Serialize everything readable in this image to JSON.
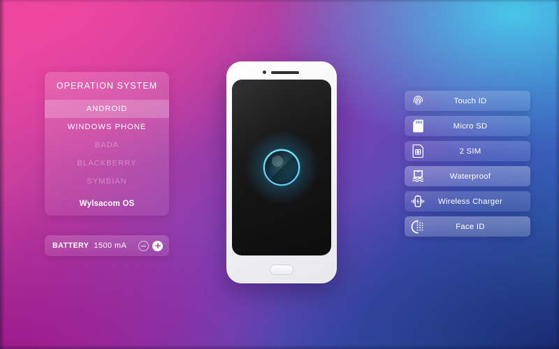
{
  "background": {
    "corner_top_left": "#ee4aa2",
    "corner_top_right": "#46cdeb",
    "corner_bottom_left": "#9e198c",
    "corner_bottom_right": "#1a266e"
  },
  "os_panel": {
    "title": "OPERATION SYSTEM",
    "items": [
      {
        "label": "ANDROID",
        "state": "selected"
      },
      {
        "label": "WINDOWS PHONE",
        "state": "available"
      },
      {
        "label": "BADA",
        "state": "disabled"
      },
      {
        "label": "BLACKBERRY",
        "state": "disabled"
      },
      {
        "label": "SYMBIAN",
        "state": "disabled"
      },
      {
        "label": "Wylsacom OS",
        "state": "highlight"
      }
    ]
  },
  "battery": {
    "label": "BATTERY",
    "value": "1500 mA",
    "decrement_icon": "minus-icon",
    "increment_icon": "plus-icon"
  },
  "phone": {
    "camera_icon": "camera-dot-icon",
    "speaker_icon": "earpiece-speaker-icon",
    "home_button_icon": "home-button-icon",
    "logo_icon": "glowing-orb-logo-icon"
  },
  "features": [
    {
      "label": "Touch ID",
      "icon": "fingerprint-icon",
      "state": "normal"
    },
    {
      "label": "Micro SD",
      "icon": "sd-card-icon",
      "state": "normal"
    },
    {
      "label": "2 SIM",
      "icon": "sim-card-icon",
      "state": "normal"
    },
    {
      "label": "Waterproof",
      "icon": "waterproof-icon",
      "state": "selected"
    },
    {
      "label": "Wireless Charger",
      "icon": "wireless-charging-icon",
      "state": "normal"
    },
    {
      "label": "Face ID",
      "icon": "face-id-icon",
      "state": "selected"
    }
  ]
}
